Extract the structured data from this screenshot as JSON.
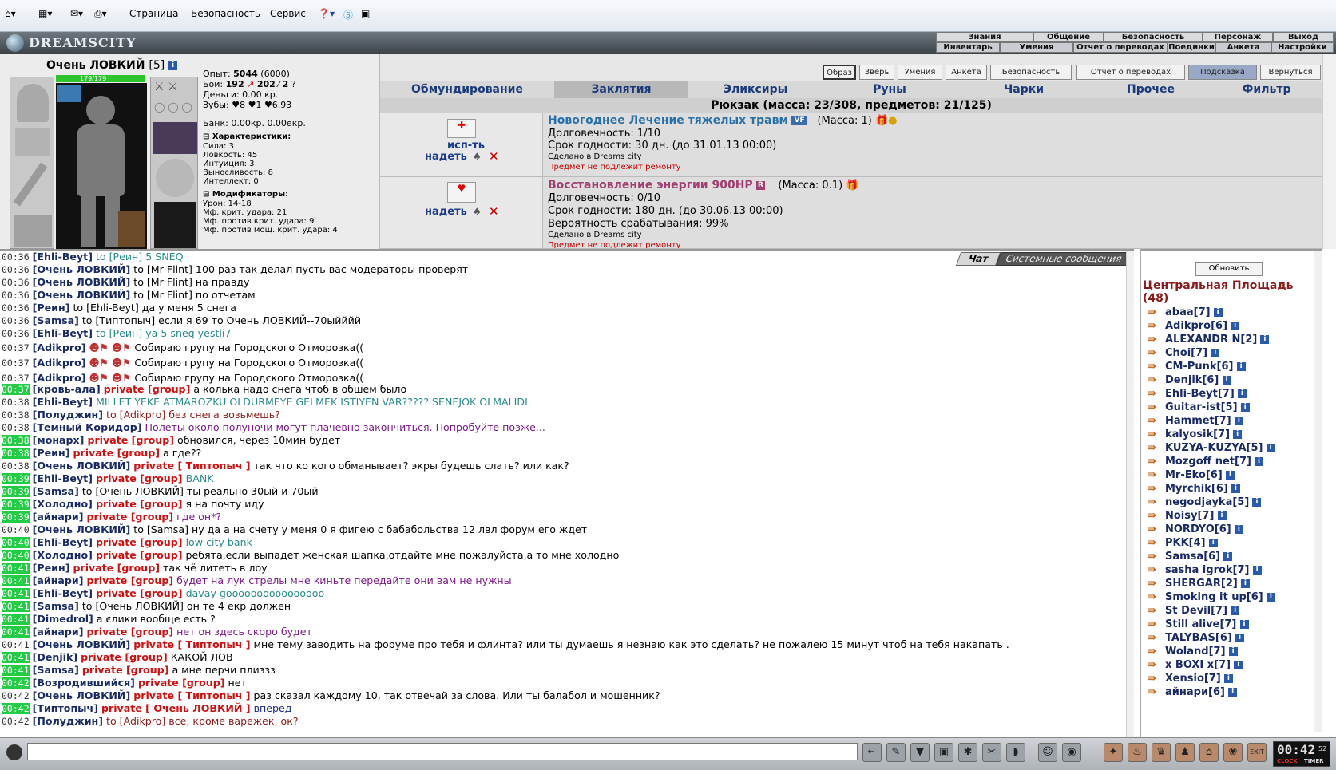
{
  "ie": {
    "menu_page": "Страница",
    "menu_security": "Безопасность",
    "menu_service": "Сервис"
  },
  "site": {
    "logo": "DREAMSCITY"
  },
  "topnav": {
    "row1": [
      "Знания",
      "Общение",
      "Безопасность",
      "Персонаж",
      "Выход"
    ],
    "row2": [
      "Инвентарь",
      "Умения",
      "Отчет о переводах",
      "Поединки",
      "Анкета",
      "Настройки"
    ]
  },
  "char": {
    "name": "Очень ЛОВКИЙ",
    "level": "[5]",
    "hp": "179/179",
    "stats": {
      "exp_label": "Опыт:",
      "exp": "5044",
      "exp_next": "(6000)",
      "fights_label": "Бои:",
      "fights": "192",
      "wins": "202",
      "draws": "2",
      "money": "Деньги: 0.00 кр.",
      "teeth": "Зубы: ♥8 ♥1 ♥6.93",
      "bank": "Банк: 0.00кр. 0.00екр."
    },
    "chars_header": "Характеристики:",
    "chars": [
      "Сила: 3",
      "Ловкость: 45",
      "Интуиция: 3",
      "Выносливость: 8",
      "Интеллект: 0"
    ],
    "mods_header": "Модификаторы:",
    "mods": [
      "Урон: 14-18",
      "Мф. крит. удара: 21",
      "Мф. против крит. удара: 9",
      "Мф. против мощ. крит. удара: 4"
    ]
  },
  "inv": {
    "buttons": [
      "Образ",
      "Зверь",
      "Умения",
      "Анкета",
      "Безопасность",
      "Отчет о переводах",
      "Подсказка",
      "Вернуться"
    ],
    "tabs": [
      "Обмундирование",
      "Заклятия",
      "Эликсиры",
      "Руны",
      "Чарки",
      "Прочее",
      "Фильтр"
    ],
    "backpack": "Рюкзак (масса: 23/308, предметов: 21/125)",
    "items": [
      {
        "use": "исп-ть",
        "wear": "надеть",
        "name": "Новогоднее Лечение тяжелых травм",
        "badge": "VF",
        "mass": "(Масса: 1)",
        "durability": "Долговечность: 1/10",
        "expiry": "Срок годности: 30 дн. (до 31.01.13 00:00)",
        "made": "Сделано в Dreams city",
        "note": "Предмет не подлежит ремонту"
      },
      {
        "wear": "надеть",
        "name": "Восстановление энергии 900HP",
        "badge": "R",
        "mass": "(Масса: 0.1)",
        "durability": "Долговечность: 0/10",
        "expiry": "Срок годности: 180 дн. (до 30.06.13 00:00)",
        "chance": "Вероятность срабатывания: 99%",
        "made": "Сделано в Dreams city",
        "note": "Предмет не подлежит ремонту"
      }
    ]
  },
  "chat": {
    "tab_chat": "Чат",
    "tab_system": "Системные сообщения",
    "lines": [
      {
        "t": "00:36",
        "n": "[Ehli-Beyt]",
        "p": "",
        "m": "to [Реин] 5 SNEQ",
        "c": "#2a8a8a",
        "g": false
      },
      {
        "t": "00:36",
        "n": "[Очень ЛОВКИЙ]",
        "p": "",
        "m": "to [Mr Flint] 100 раз так делал пусть вас модераторы проверят",
        "c": "#000",
        "g": false
      },
      {
        "t": "00:36",
        "n": "[Очень ЛОВКИЙ]",
        "p": "",
        "m": "to [Mr Flint] на правду",
        "c": "#000",
        "g": false
      },
      {
        "t": "00:36",
        "n": "[Очень ЛОВКИЙ]",
        "p": "",
        "m": "to [Mr Flint] по отчетам",
        "c": "#000",
        "g": false
      },
      {
        "t": "00:36",
        "n": "[Реин]",
        "p": "",
        "m": "to [Ehli-Beyt] да у меня 5 снега",
        "c": "#000",
        "g": false
      },
      {
        "t": "00:36",
        "n": "[Samsa]",
        "p": "",
        "m": "to [Типтопыч] если я 69 то Очень ЛОВКИЙ--70ыйййй",
        "c": "#000",
        "g": false
      },
      {
        "t": "00:36",
        "n": "[Ehli-Beyt]",
        "p": "",
        "m": "to [Реин] ya 5 sneq yestli7",
        "c": "#2a8a8a",
        "g": false
      },
      {
        "t": "00:37",
        "n": "[Adikpro]",
        "p": "",
        "m": "Собираю групу на Городского Отморозка((",
        "c": "#000",
        "g": false,
        "smiles": true
      },
      {
        "t": "00:37",
        "n": "[Adikpro]",
        "p": "",
        "m": "Собираю групу на Городского Отморозка((",
        "c": "#000",
        "g": false,
        "smiles": true
      },
      {
        "t": "00:37",
        "n": "[Adikpro]",
        "p": "",
        "m": "Собираю групу на Городского Отморозка((",
        "c": "#000",
        "g": false,
        "smiles": true
      },
      {
        "t": "00:37",
        "n": "[кровь-ала]",
        "p": "private [group]",
        "m": "а колька надо снега чтоб в обшем было",
        "c": "#000",
        "g": true
      },
      {
        "t": "00:38",
        "n": "[Ehli-Beyt]",
        "p": "",
        "m": "MILLET YEKE ATMAROZKU OLDURMEYE GELMEK ISTIYEN VAR????? SENEJOK OLMALIDI",
        "c": "#2a8a8a",
        "g": false
      },
      {
        "t": "00:38",
        "n": "[Полуджин]",
        "p": "",
        "m": "to [Adikpro] без снега возьмешь?",
        "c": "#8b1a1a",
        "g": false
      },
      {
        "t": "00:38",
        "n": "[Темный Коридор]",
        "p": "",
        "m": "Полеты около полуночи могут плачевно закончиться. Попробуйте позже...",
        "c": "#7a1a8a",
        "g": false
      },
      {
        "t": "00:38",
        "n": "[монарх]",
        "p": "private [group]",
        "m": "обновился, через 10мин будет",
        "c": "#000",
        "g": true
      },
      {
        "t": "00:38",
        "n": "[Реин]",
        "p": "private [group]",
        "m": "а где??",
        "c": "#000",
        "g": true
      },
      {
        "t": "00:38",
        "n": "[Очень ЛОВКИЙ]",
        "p": "private [ Типтопыч ]",
        "m": "так что ко кого обманывает? экры будешь слать? или как?",
        "c": "#000",
        "g": false
      },
      {
        "t": "00:39",
        "n": "[Ehli-Beyt]",
        "p": "private [group]",
        "m": "BANK",
        "c": "#2a8a8a",
        "g": true
      },
      {
        "t": "00:39",
        "n": "[Samsa]",
        "p": "",
        "m": "to [Очень ЛОВКИЙ] ты реально 30ый и 70ый",
        "c": "#000",
        "g": true
      },
      {
        "t": "00:39",
        "n": "[Холодно]",
        "p": "private [group]",
        "m": "я на почту иду",
        "c": "#000",
        "g": true
      },
      {
        "t": "00:39",
        "n": "[айнари]",
        "p": "private [group]",
        "m": "где он*?",
        "c": "#7a1a8a",
        "g": true
      },
      {
        "t": "00:40",
        "n": "[Очень ЛОВКИЙ]",
        "p": "",
        "m": "to [Samsa] ну да а на счету у меня 0 я фигею с бабабольства 12 лвл форум его ждет",
        "c": "#000",
        "g": false
      },
      {
        "t": "00:40",
        "n": "[Ehli-Beyt]",
        "p": "private [group]",
        "m": "low city bank",
        "c": "#2a8a8a",
        "g": true
      },
      {
        "t": "00:40",
        "n": "[Холодно]",
        "p": "private [group]",
        "m": "ребята,если выпадет женская шапка,отдайте мне пожалуйста,а то мне холодно",
        "c": "#000",
        "g": true
      },
      {
        "t": "00:41",
        "n": "[Реин]",
        "p": "private [group]",
        "m": "так чё литеть в лоу",
        "c": "#000",
        "g": true
      },
      {
        "t": "00:41",
        "n": "[айнари]",
        "p": "private [group]",
        "m": "будет на лук стрелы мне киньте передайте они вам не нужны",
        "c": "#7a1a8a",
        "g": true
      },
      {
        "t": "00:41",
        "n": "[Ehli-Beyt]",
        "p": "private [group]",
        "m": "davay goooooooooooooooo",
        "c": "#2a8a8a",
        "g": true
      },
      {
        "t": "00:41",
        "n": "[Samsa]",
        "p": "",
        "m": "to [Очень ЛОВКИЙ] он те 4 екр должен",
        "c": "#000",
        "g": true
      },
      {
        "t": "00:41",
        "n": "[Dimedrol]",
        "p": "",
        "m": "а єлики вообще есть ?",
        "c": "#000",
        "g": true
      },
      {
        "t": "00:41",
        "n": "[айнари]",
        "p": "private [group]",
        "m": "нет он здесь скоро будет",
        "c": "#7a1a8a",
        "g": true
      },
      {
        "t": "00:41",
        "n": "[Очень ЛОВКИЙ]",
        "p": "private [ Типтопыч ]",
        "m": "мне тему заводить на форуме про тебя и флинта? или ты думаешь я незнаю как это сделать? не пожалею 15 минут чтоб на тебя накапать .",
        "c": "#000",
        "g": false
      },
      {
        "t": "00:41",
        "n": "[Denjik]",
        "p": "private [group]",
        "m": "КАКОЙ ЛОВ",
        "c": "#000",
        "g": true
      },
      {
        "t": "00:41",
        "n": "[Samsa]",
        "p": "private [group]",
        "m": "а мне перчи плиззз",
        "c": "#000",
        "g": true
      },
      {
        "t": "00:42",
        "n": "[Возродившийся]",
        "p": "private [group]",
        "m": "нет",
        "c": "#000",
        "g": true
      },
      {
        "t": "00:42",
        "n": "[Очень ЛОВКИЙ]",
        "p": "private [ Типтопыч ]",
        "m": "раз сказал каждому 10, так отвечай за слова. Или ты балабол и мошенник?",
        "c": "#000",
        "g": false
      },
      {
        "t": "00:42",
        "n": "[Типтопыч]",
        "p": "private [ Очень ЛОВКИЙ ]",
        "m": "вперед",
        "c": "#1a2a8a",
        "g": true
      },
      {
        "t": "00:42",
        "n": "[Полуджин]",
        "p": "",
        "m": "to [Adikpro] все, кроме варежек, ок?",
        "c": "#8b1a1a",
        "g": false
      }
    ]
  },
  "users": {
    "refresh": "Обновить",
    "room": "Центральная Площадь",
    "count": "(48)",
    "list": [
      "abaa[7]",
      "Adikpro[6]",
      "ALEXANDR N[2]",
      "Choi[7]",
      "CM-Punk[6]",
      "Denjik[6]",
      "Ehli-Beyt[7]",
      "Guitar-ist[5]",
      "Hammet[7]",
      "kalyosik[7]",
      "KUZYA-KUZYA[5]",
      "Mozgoff net[7]",
      "Mr-Eko[6]",
      "Myrchik[6]",
      "negodjayka[5]",
      "Noisy[7]",
      "NORDYO[6]",
      "PKK[4]",
      "Samsa[6]",
      "sasha igrok[7]",
      "SHERGAR[2]",
      "Smoking it up[6]",
      "St Devil[7]",
      "Still alive[7]",
      "TALYBAS[6]",
      "Woland[7]",
      "x BOXI x[7]",
      "Xensio[7]",
      "айнари[6]"
    ]
  },
  "clock": {
    "time": "00:42",
    "sec": "52",
    "clock_label": "CLOCK",
    "timer_label": "TIMER"
  }
}
